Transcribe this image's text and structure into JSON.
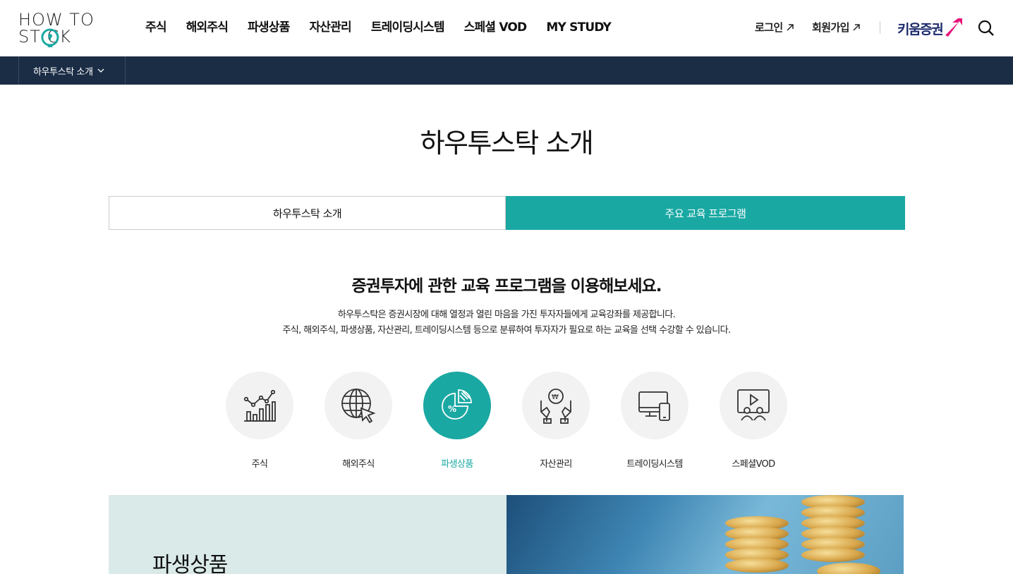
{
  "header": {
    "logo_line1": "HOW TO",
    "logo_line2": "ST  CK",
    "gnb": [
      "주식",
      "해외주식",
      "파생상품",
      "자산관리",
      "트레이딩시스템",
      "스페셜 VOD",
      "MY STUDY"
    ],
    "login": "로그인",
    "signup": "회원가입",
    "partner_logo": "키움증권"
  },
  "subnav": {
    "current": "하우투스탁 소개"
  },
  "page": {
    "title": "하우투스탁 소개",
    "tabs": [
      {
        "label": "하우투스탁 소개",
        "active": false
      },
      {
        "label": "주요 교육 프로그램",
        "active": true
      }
    ],
    "intro_heading": "증권투자에 관한 교육 프로그램을 이용해보세요.",
    "intro_line1": "하우투스탁은 증권시장에 대해 열정과 열린 마음을 가진 투자자들에게 교육강좌를 제공합니다.",
    "intro_line2": "주식, 해외주식, 파생상품, 자산관리, 트레이딩시스템 등으로 분류하여 투자자가 필요로 하는 교육을 선택 수강할 수 있습니다."
  },
  "categories": [
    {
      "label": "주식",
      "icon": "stock-chart-icon",
      "active": false
    },
    {
      "label": "해외주식",
      "icon": "globe-cursor-icon",
      "active": false
    },
    {
      "label": "파생상품",
      "icon": "pie-percent-icon",
      "active": true
    },
    {
      "label": "자산관리",
      "icon": "hands-coin-icon",
      "active": false
    },
    {
      "label": "트레이딩시스템",
      "icon": "devices-icon",
      "active": false
    },
    {
      "label": "스페셜VOD",
      "icon": "video-people-icon",
      "active": false
    }
  ],
  "banner": {
    "title": "파생상품"
  },
  "colors": {
    "accent": "#1aa8a3",
    "navy": "#1b2c45",
    "banner_bg": "#daeae9",
    "partner_pink": "#e6157a"
  }
}
